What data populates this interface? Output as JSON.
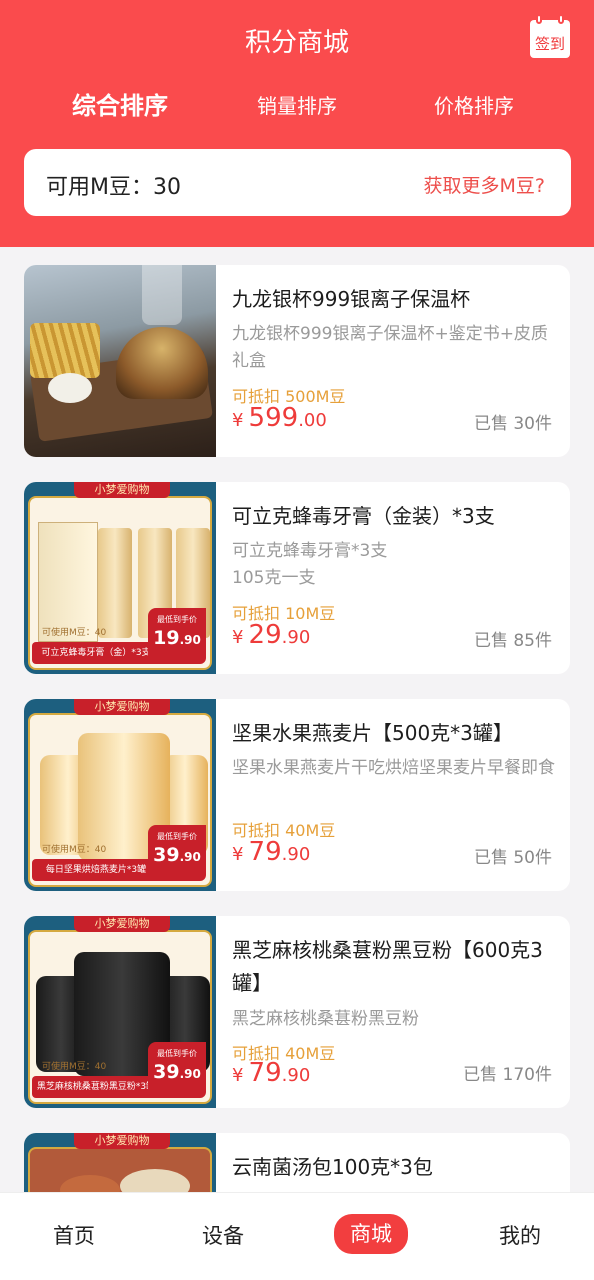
{
  "header": {
    "title": "积分商城",
    "sign_in": "签到"
  },
  "sort_tabs": [
    {
      "label": "综合排序",
      "active": true
    },
    {
      "label": "销量排序",
      "active": false
    },
    {
      "label": "价格排序",
      "active": false
    }
  ],
  "points": {
    "label": "可用M豆：30",
    "link": "获取更多M豆?"
  },
  "products": [
    {
      "title": "九龙银杯999银离子保温杯",
      "desc": "九龙银杯999银离子保温杯+鉴定书+皮质礼盒",
      "deduct": "可抵扣 500M豆",
      "currency": "¥",
      "price_int": "599",
      "price_dec": ".00",
      "sold": "已售 30件"
    },
    {
      "title": "可立克蜂毒牙膏（金装）*3支",
      "desc": "可立克蜂毒牙膏*3支\n105克一支",
      "deduct": "可抵扣 10M豆",
      "currency": "¥",
      "price_int": "29",
      "price_dec": ".90",
      "sold": "已售 85件",
      "image": {
        "banner": "小梦爱购物",
        "points": "可使用M豆：40",
        "footer": "可立克蜂毒牙膏（金）*3支",
        "badge_label": "最低到手价",
        "badge_int": "19",
        "badge_dec": ".90"
      }
    },
    {
      "title": "坚果水果燕麦片【500克*3罐】",
      "desc": "坚果水果燕麦片干吃烘焙坚果麦片早餐即食",
      "deduct": "可抵扣 40M豆",
      "currency": "¥",
      "price_int": "79",
      "price_dec": ".90",
      "sold": "已售 50件",
      "image": {
        "banner": "小梦爱购物",
        "points": "可使用M豆：40",
        "footer": "每日坚果烘焙燕麦片*3罐",
        "badge_label": "最低到手价",
        "badge_int": "39",
        "badge_dec": ".90"
      }
    },
    {
      "title": "黑芝麻核桃桑葚粉黑豆粉【600克3罐】",
      "desc": "黑芝麻核桃桑葚粉黑豆粉",
      "deduct": "可抵扣 40M豆",
      "currency": "¥",
      "price_int": "79",
      "price_dec": ".90",
      "sold": "已售 170件",
      "image": {
        "banner": "小梦爱购物",
        "points": "可使用M豆：40",
        "footer": "黑芝麻核桃桑葚粉黑豆粉*3罐",
        "badge_label": "最低到手价",
        "badge_int": "39",
        "badge_dec": ".90"
      }
    },
    {
      "title": "云南菌汤包100克*3包",
      "image": {
        "banner": "小梦爱购物"
      }
    }
  ],
  "bottom_nav": [
    {
      "label": "首页",
      "active": false
    },
    {
      "label": "设备",
      "active": false
    },
    {
      "label": "商城",
      "active": true
    },
    {
      "label": "我的",
      "active": false
    }
  ],
  "colors": {
    "brand_red": "#fa4b4d",
    "price_red": "#ee3b3a",
    "deduct_orange": "#e6a03a",
    "background": "#f4f3f5"
  }
}
